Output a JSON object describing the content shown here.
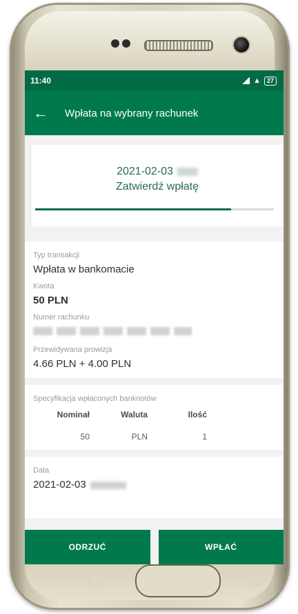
{
  "status_bar": {
    "time": "11:40",
    "battery": "27"
  },
  "app_bar": {
    "title": "Wpłata na wybrany rachunek"
  },
  "confirm": {
    "date": "2021-02-03",
    "title": "Zatwierdź wpłatę",
    "progress": 0.82
  },
  "details": {
    "type_label": "Typ transakcji",
    "type_value": "Wpłata w bankomacie",
    "amount_label": "Kwota",
    "amount_value": "50 PLN",
    "account_label": "Numer rachunku",
    "commission_label": "Przewidywana prowizja",
    "commission_value": "4.66 PLN + 4.00 PLN"
  },
  "notes": {
    "label": "Specyfikacja wpłaconych banknotów",
    "columns": [
      "Nominał",
      "Waluta",
      "Ilość"
    ],
    "rows": [
      [
        "50",
        "PLN",
        "1"
      ]
    ]
  },
  "date_section": {
    "label": "Data",
    "value": "2021-02-03"
  },
  "actions": {
    "reject": "ODRZUĆ",
    "deposit": "WPŁAĆ"
  }
}
